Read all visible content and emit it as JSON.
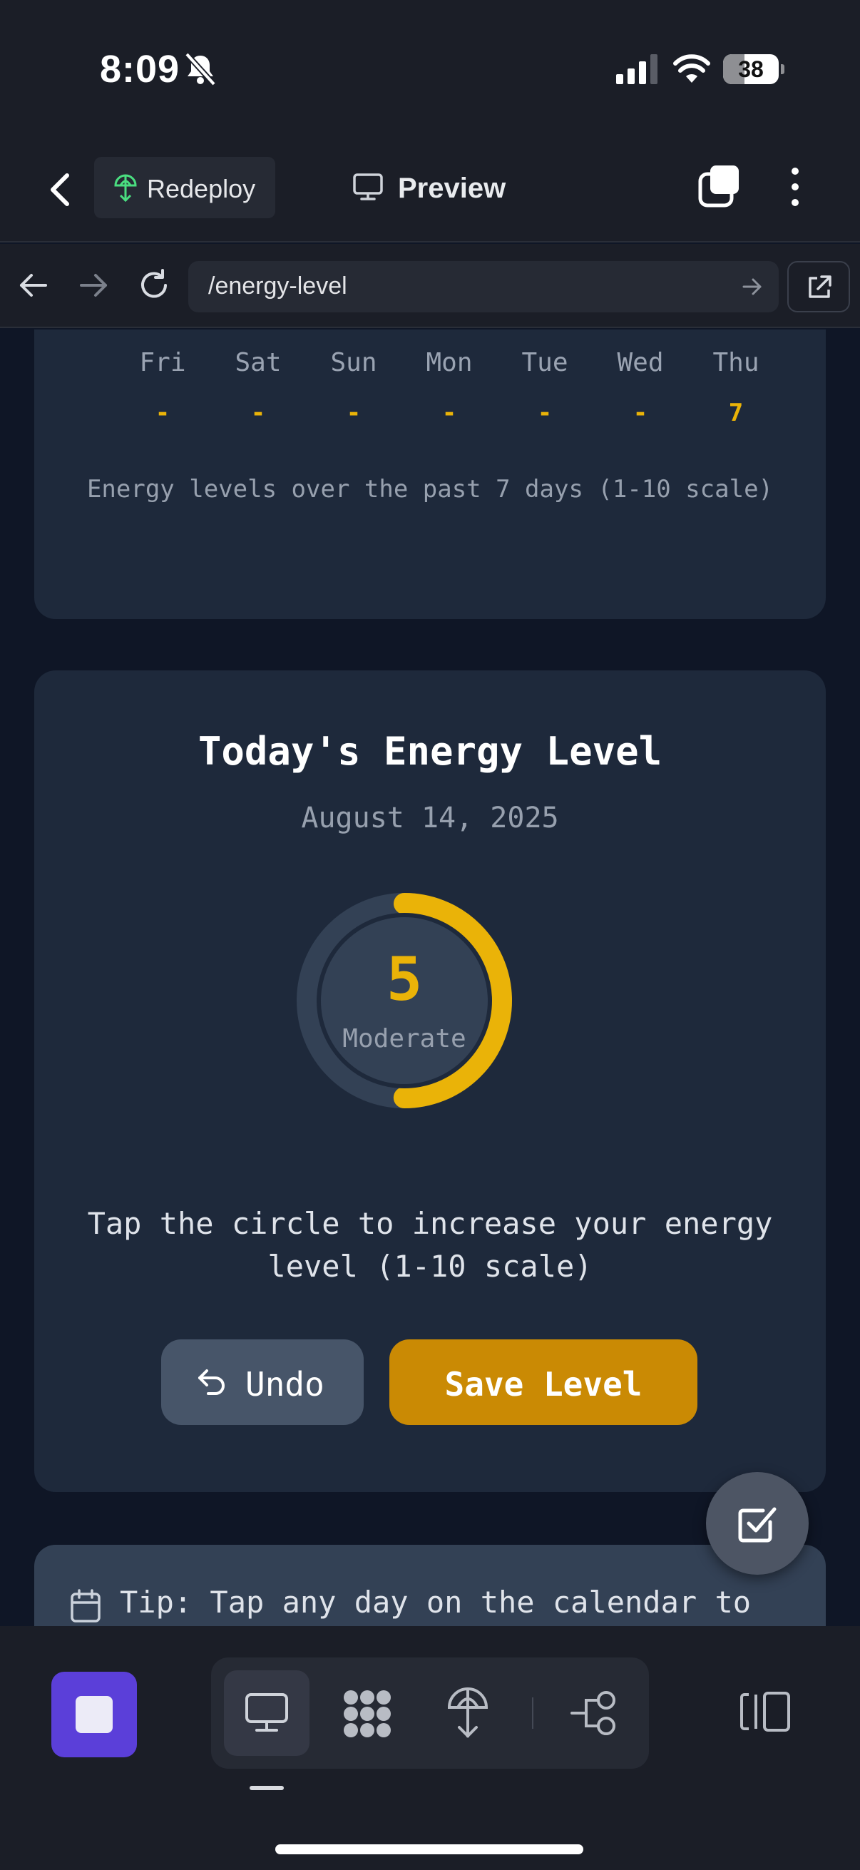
{
  "status_bar": {
    "time": "8:09",
    "battery_level": "38",
    "battery_fraction": 0.38,
    "icons": [
      "bell-slash-icon",
      "cellular-signal-icon",
      "wifi-icon",
      "battery-icon"
    ]
  },
  "app_header": {
    "back_icon": "chevron-left-icon",
    "redeploy_label": "Redeploy",
    "redeploy_icon": "deploy-icon",
    "preview_label": "Preview",
    "preview_icon": "monitor-icon",
    "tabs_icon": "tabs-icon",
    "menu_icon": "kebab-menu-icon"
  },
  "browser_bar": {
    "url": "/energy-level",
    "icons": [
      "arrow-left-icon",
      "arrow-right-icon",
      "reload-icon",
      "go-arrow-icon",
      "external-link-icon"
    ]
  },
  "week": {
    "days": [
      {
        "name": "Fri",
        "value": "-"
      },
      {
        "name": "Sat",
        "value": "-"
      },
      {
        "name": "Sun",
        "value": "-"
      },
      {
        "name": "Mon",
        "value": "-"
      },
      {
        "name": "Tue",
        "value": "-"
      },
      {
        "name": "Wed",
        "value": "-"
      },
      {
        "name": "Thu",
        "value": "7"
      }
    ],
    "caption": "Energy levels over the past 7 days (1-10 scale)"
  },
  "today": {
    "title": "Today's Energy Level",
    "date": "August 14, 2025",
    "level": "5",
    "level_fraction": 0.5,
    "level_label": "Moderate",
    "instruction": "Tap the circle to increase your energy level (1-10 scale)",
    "undo_label": "Undo",
    "save_label": "Save Level"
  },
  "tip": {
    "text": "Tip: Tap any day on the calendar to"
  },
  "colors": {
    "accent": "#eab308",
    "save_button": "#ca8a04",
    "card": "#1e293b",
    "stop_button": "#5b3fd9"
  },
  "bottom_toolbar": {
    "icons": [
      "stop-icon",
      "monitor-icon",
      "dots-grid-icon",
      "deploy-icon",
      "flow-icon",
      "panel-toggle-icon"
    ]
  }
}
